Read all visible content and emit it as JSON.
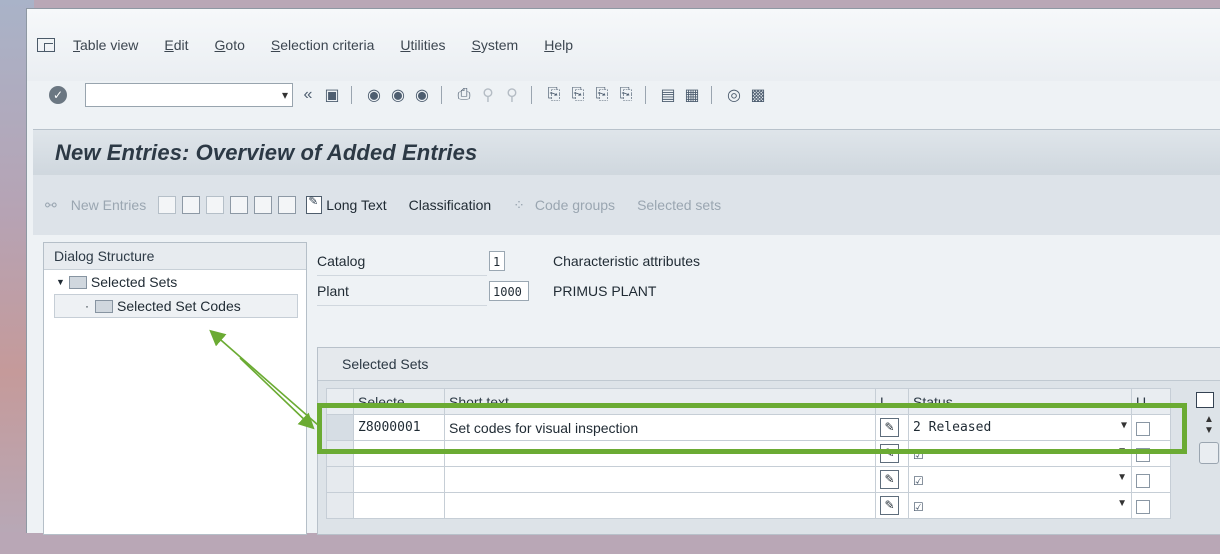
{
  "menu": {
    "items": [
      "Table view",
      "Edit",
      "Goto",
      "Selection criteria",
      "Utilities",
      "System",
      "Help"
    ]
  },
  "toolbar": {
    "command_field_value": "",
    "icons": [
      "enter-icon",
      "back-icon",
      "save-icon",
      "back-nav-icon",
      "exit-icon",
      "cancel-icon",
      "print-icon",
      "find-icon",
      "find-next-icon",
      "first-page-icon",
      "prev-page-icon",
      "next-page-icon",
      "last-page-icon",
      "create-session-icon",
      "shortcut-icon",
      "help-icon",
      "layout-icon"
    ]
  },
  "title": "New Entries: Overview of Added Entries",
  "app_toolbar": {
    "new_entries": "New Entries",
    "long_text": "Long Text",
    "classification": "Classification",
    "code_groups": "Code groups",
    "selected_sets": "Selected sets"
  },
  "dialog_structure": {
    "header": "Dialog Structure",
    "items": [
      {
        "label": "Selected Sets",
        "level": 1
      },
      {
        "label": "Selected Set Codes",
        "level": 2
      }
    ]
  },
  "fields": {
    "catalog": {
      "label": "Catalog",
      "value": "1",
      "description": "Characteristic attributes"
    },
    "plant": {
      "label": "Plant",
      "value": "1000",
      "description": "PRIMUS PLANT"
    }
  },
  "table": {
    "title": "Selected Sets",
    "columns": [
      "Selecte...",
      "Short text",
      "L...",
      "Status",
      "U..."
    ],
    "rows": [
      {
        "code": "Z8000001",
        "short_text": "Set codes for visual inspection",
        "status": "2 Released"
      },
      {
        "code": "",
        "short_text": "",
        "status": "☑"
      },
      {
        "code": "",
        "short_text": "",
        "status": "☑"
      },
      {
        "code": "",
        "short_text": "",
        "status": "☑"
      }
    ]
  },
  "colors": {
    "highlight": "#6bab33",
    "title_bar": "#cfd7de"
  }
}
